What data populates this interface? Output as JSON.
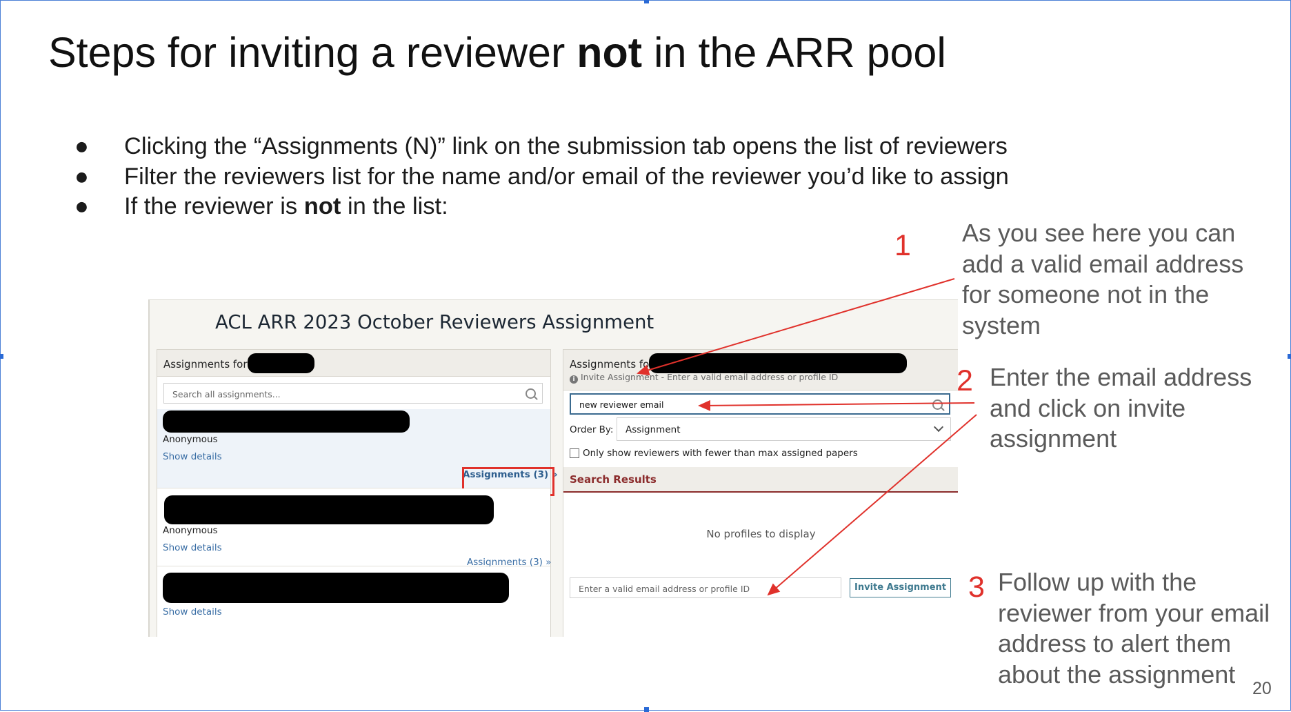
{
  "slide": {
    "title_pre": "Steps for inviting a reviewer ",
    "title_bold": "not",
    "title_post": " in the ARR pool",
    "bullets": [
      {
        "marker": "●",
        "text_pre": "Clicking the “Assignments (N)” link on the submission tab opens the list of reviewers",
        "bold": "",
        "text_post": ""
      },
      {
        "marker": "●",
        "text_pre": "Filter the reviewers list for the name and/or email of the reviewer you’d like to assign",
        "bold": "",
        "text_post": ""
      },
      {
        "marker": "●",
        "text_pre": "If the reviewer is ",
        "bold": "not",
        "text_post": " in the list:"
      }
    ],
    "page_number": "20",
    "accent_color": "#e0312b"
  },
  "annotations": [
    {
      "number": "1",
      "lines": [
        "As you see here you can",
        "add a valid email address",
        "for someone not in the",
        "system"
      ]
    },
    {
      "number": "2",
      "lines": [
        "Enter the email address",
        "and click on invite",
        "assignment"
      ]
    },
    {
      "number": "3",
      "lines": [
        "Follow up with the",
        "reviewer from your email",
        "address to alert them",
        "about the assignment"
      ]
    }
  ],
  "screenshot": {
    "title": "ACL ARR 2023 October Reviewers Assignment",
    "left_panel": {
      "header": "Assignments for",
      "search_placeholder": "Search all assignments...",
      "reviewers": [
        {
          "name_text": "Anonymous",
          "show_details": "Show details",
          "assignments_link": "Assignments (3) »"
        },
        {
          "name_text": "Anonymous",
          "show_details": "Show details",
          "assignments_link": "Assignments (3) »"
        },
        {
          "show_details": "Show details"
        }
      ]
    },
    "right_panel": {
      "header": "Assignments for",
      "invite_hint": "Invite Assignment - Enter a valid email address or profile ID",
      "email_value": "new reviewer email",
      "order_by_label": "Order By:",
      "order_by_value": "Assignment",
      "checkbox_label": "Only show reviewers with fewer than max assigned papers",
      "results_title": "Search Results",
      "empty_message": "No profiles to display",
      "invite_placeholder": "Enter a valid email address or profile ID",
      "invite_button": "Invite Assignment"
    }
  }
}
